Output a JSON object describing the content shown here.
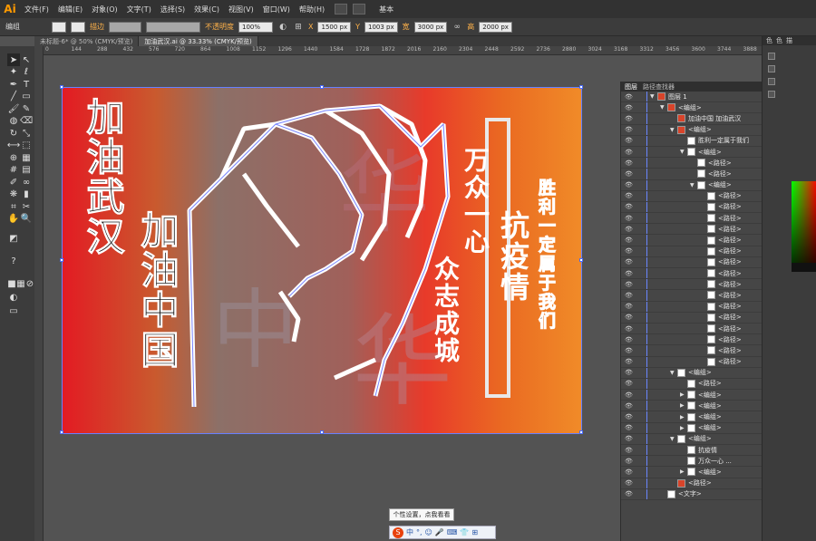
{
  "app": {
    "logo": "Ai"
  },
  "menu": [
    "文件(F)",
    "编辑(E)",
    "对象(O)",
    "文字(T)",
    "选择(S)",
    "效果(C)",
    "视图(V)",
    "窗口(W)",
    "帮助(H)"
  ],
  "workspace_label": "基本",
  "control": {
    "object_type": "编组",
    "stroke_label": "描边",
    "opacity_label": "不透明度",
    "opacity_value": "100%",
    "x_label": "X",
    "x_value": "1500 px",
    "y_label": "Y",
    "y_value": "1003 px",
    "w_label": "宽",
    "w_value": "3000 px",
    "h_label": "高",
    "h_value": "2000 px"
  },
  "tabs": [
    {
      "label": "未标题-6* @ 50% (CMYK/预览)",
      "active": false
    },
    {
      "label": "加油武汉.ai @ 33.33% (CMYK/预览)",
      "active": true
    }
  ],
  "ruler_ticks": [
    "0",
    "144",
    "288",
    "432",
    "576",
    "720",
    "864",
    "1008",
    "1152",
    "1296",
    "1440",
    "1584",
    "1728",
    "1872",
    "2016",
    "2160",
    "2304",
    "2448",
    "2592",
    "2736",
    "2880",
    "3024",
    "3168",
    "3312",
    "3456",
    "3600",
    "3744",
    "3888"
  ],
  "artwork": {
    "col1": "加油武汉",
    "col2": "加油中国",
    "col3": "抗疫情",
    "col4": "万众一心",
    "col5": "众志成城",
    "col6": "胜利一定属于我们",
    "bg_left": "#e31b23",
    "bg_right": "#f08b28"
  },
  "tooltip": "个性设置，点我看看",
  "ime": {
    "logo": "S",
    "items": [
      "中",
      "°,",
      "☺",
      "🎤",
      "⌨",
      "👕",
      "⊞"
    ]
  },
  "layers_panel": {
    "tabs": [
      "图层",
      "路径查找器"
    ],
    "rows": [
      {
        "indent": 0,
        "arrow": "▼",
        "thumb": "red",
        "name": "图层 1",
        "eye": "👁"
      },
      {
        "indent": 1,
        "arrow": "▼",
        "thumb": "red",
        "name": "<编组>",
        "eye": "👁"
      },
      {
        "indent": 2,
        "arrow": "",
        "thumb": "red",
        "name": "加油中国 加油武汉",
        "eye": "👁"
      },
      {
        "indent": 2,
        "arrow": "▼",
        "thumb": "red",
        "name": "<编组>",
        "eye": "👁"
      },
      {
        "indent": 3,
        "arrow": "",
        "thumb": "white",
        "name": "胜利一定属于我们",
        "eye": "👁"
      },
      {
        "indent": 3,
        "arrow": "▼",
        "thumb": "white",
        "name": "<编组>",
        "eye": "👁"
      },
      {
        "indent": 4,
        "arrow": "",
        "thumb": "white",
        "name": "<路径>",
        "eye": "👁"
      },
      {
        "indent": 4,
        "arrow": "",
        "thumb": "white",
        "name": "<路径>",
        "eye": "👁"
      },
      {
        "indent": 4,
        "arrow": "▼",
        "thumb": "white",
        "name": "<编组>",
        "eye": "👁"
      },
      {
        "indent": 5,
        "arrow": "",
        "thumb": "white",
        "name": "<路径>",
        "eye": "👁"
      },
      {
        "indent": 5,
        "arrow": "",
        "thumb": "white",
        "name": "<路径>",
        "eye": "👁"
      },
      {
        "indent": 5,
        "arrow": "",
        "thumb": "white",
        "name": "<路径>",
        "eye": "👁"
      },
      {
        "indent": 5,
        "arrow": "",
        "thumb": "white",
        "name": "<路径>",
        "eye": "👁"
      },
      {
        "indent": 5,
        "arrow": "",
        "thumb": "white",
        "name": "<路径>",
        "eye": "👁"
      },
      {
        "indent": 5,
        "arrow": "",
        "thumb": "white",
        "name": "<路径>",
        "eye": "👁"
      },
      {
        "indent": 5,
        "arrow": "",
        "thumb": "white",
        "name": "<路径>",
        "eye": "👁"
      },
      {
        "indent": 5,
        "arrow": "",
        "thumb": "white",
        "name": "<路径>",
        "eye": "👁"
      },
      {
        "indent": 5,
        "arrow": "",
        "thumb": "white",
        "name": "<路径>",
        "eye": "👁"
      },
      {
        "indent": 5,
        "arrow": "",
        "thumb": "white",
        "name": "<路径>",
        "eye": "👁"
      },
      {
        "indent": 5,
        "arrow": "",
        "thumb": "white",
        "name": "<路径>",
        "eye": "👁"
      },
      {
        "indent": 5,
        "arrow": "",
        "thumb": "white",
        "name": "<路径>",
        "eye": "👁"
      },
      {
        "indent": 5,
        "arrow": "",
        "thumb": "white",
        "name": "<路径>",
        "eye": "👁"
      },
      {
        "indent": 5,
        "arrow": "",
        "thumb": "white",
        "name": "<路径>",
        "eye": "👁"
      },
      {
        "indent": 5,
        "arrow": "",
        "thumb": "white",
        "name": "<路径>",
        "eye": "👁"
      },
      {
        "indent": 5,
        "arrow": "",
        "thumb": "white",
        "name": "<路径>",
        "eye": "👁"
      },
      {
        "indent": 2,
        "arrow": "▼",
        "thumb": "white",
        "name": "<编组>",
        "eye": "👁"
      },
      {
        "indent": 3,
        "arrow": "",
        "thumb": "white",
        "name": "<路径>",
        "eye": "👁"
      },
      {
        "indent": 3,
        "arrow": "▶",
        "thumb": "white",
        "name": "<编组>",
        "eye": "👁"
      },
      {
        "indent": 3,
        "arrow": "▶",
        "thumb": "white",
        "name": "<编组>",
        "eye": "👁"
      },
      {
        "indent": 3,
        "arrow": "▶",
        "thumb": "white",
        "name": "<编组>",
        "eye": "👁"
      },
      {
        "indent": 3,
        "arrow": "▶",
        "thumb": "white",
        "name": "<编组>",
        "eye": "👁"
      },
      {
        "indent": 2,
        "arrow": "▼",
        "thumb": "white",
        "name": "<编组>",
        "eye": "👁"
      },
      {
        "indent": 3,
        "arrow": "",
        "thumb": "white",
        "name": "抗疫情",
        "eye": "👁"
      },
      {
        "indent": 3,
        "arrow": "",
        "thumb": "white",
        "name": "万众一心   ...",
        "eye": "👁"
      },
      {
        "indent": 3,
        "arrow": "▶",
        "thumb": "white",
        "name": "<编组>",
        "eye": "👁"
      },
      {
        "indent": 2,
        "arrow": "",
        "thumb": "red",
        "name": "<路径>",
        "eye": "👁"
      },
      {
        "indent": 1,
        "arrow": "",
        "thumb": "white",
        "name": "<文字>",
        "eye": "👁"
      }
    ]
  },
  "right_panel": {
    "tabs": [
      "色",
      "色",
      "描"
    ]
  }
}
